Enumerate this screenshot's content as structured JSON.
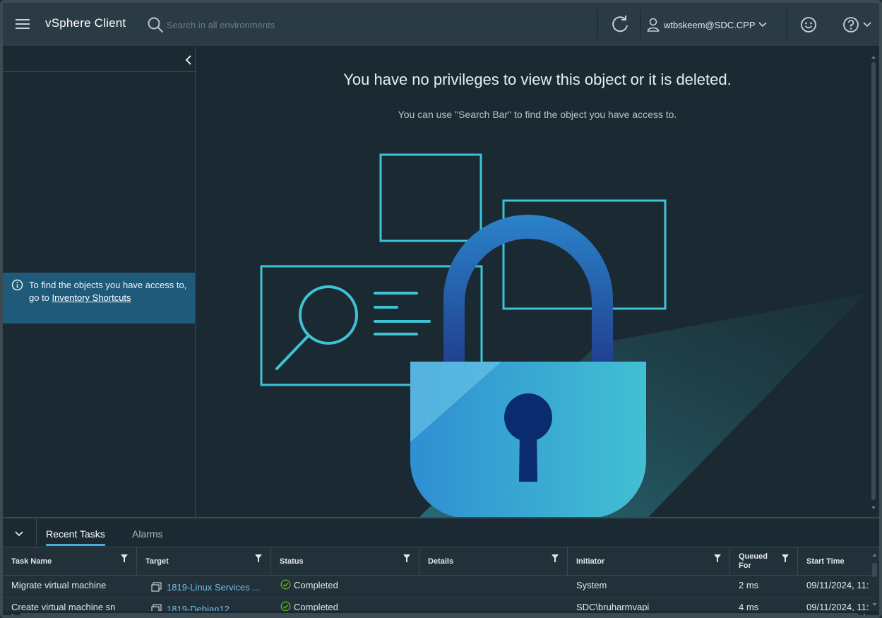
{
  "header": {
    "app_title": "vSphere Client",
    "search_placeholder": "Search in all environments",
    "user": "wtbskeem@SDC.CPP"
  },
  "sidebar": {
    "info_text": "To find the objects you have access to, go to",
    "info_link": "Inventory Shortcuts"
  },
  "main": {
    "title": "You have no privileges to view this object or it is deleted.",
    "subtitle": "You can use \"Search Bar\" to find the object you have access to."
  },
  "bottom": {
    "tabs": [
      {
        "label": "Recent Tasks",
        "active": true
      },
      {
        "label": "Alarms",
        "active": false
      }
    ],
    "columns": [
      "Task Name",
      "Target",
      "Status",
      "Details",
      "Initiator",
      "Queued For",
      "Start Time"
    ],
    "rows": [
      {
        "task": "Migrate virtual machine",
        "target": "1819-Linux Services ...",
        "status": "Completed",
        "details": "",
        "initiator": "System",
        "queued": "2 ms",
        "start": "09/11/2024, 11:"
      },
      {
        "task": "Create virtual machine sn",
        "target": "1819-Debian12",
        "status": "Completed",
        "details": "",
        "initiator": "SDC\\bruharmvapi",
        "queued": "4 ms",
        "start": "09/11/2024, 11:"
      }
    ]
  },
  "colors": {
    "header_bg": "#2b3b46",
    "page_bg": "#1b2a32",
    "accent": "#49afd9",
    "info_bg": "#1f5a7a",
    "link": "#6cc1ea",
    "success": "#5eb715"
  }
}
